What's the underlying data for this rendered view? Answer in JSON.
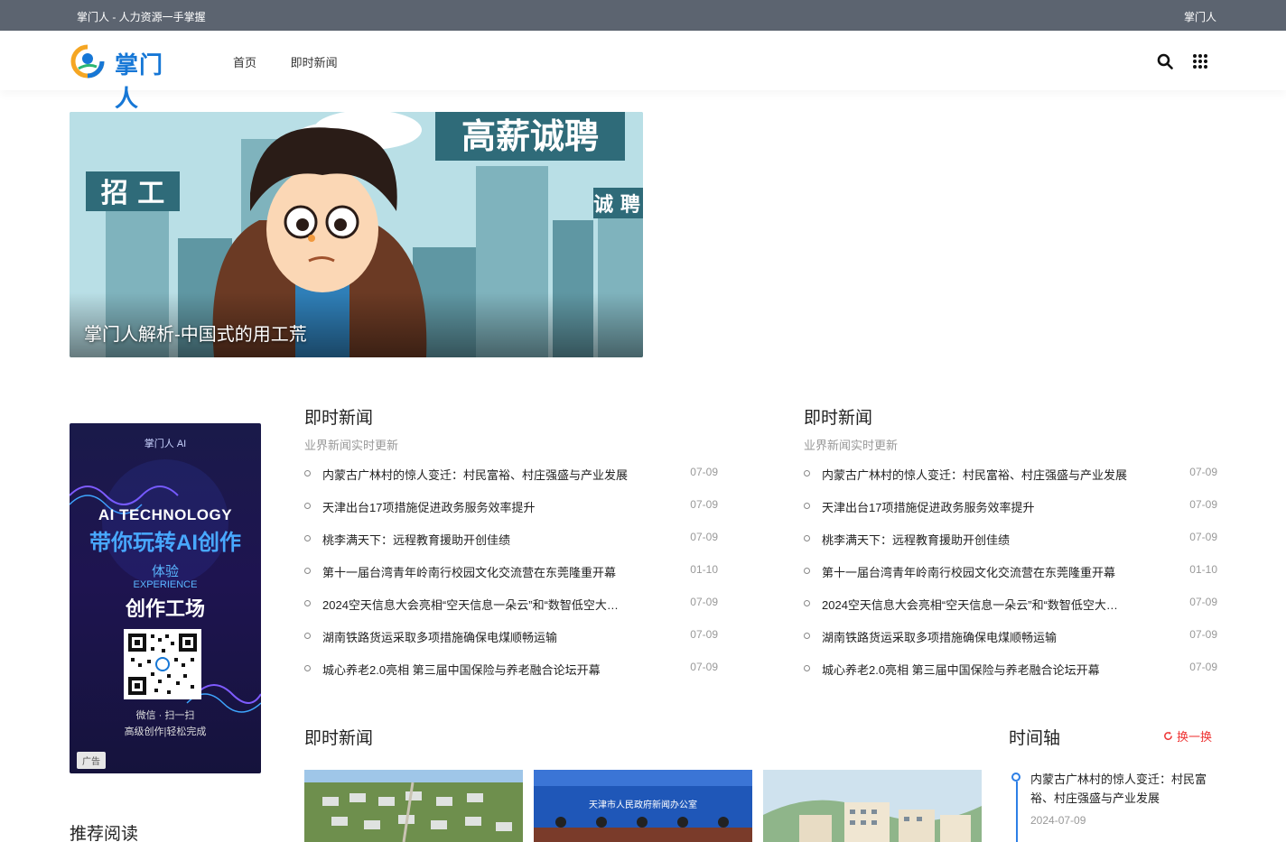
{
  "topbar": {
    "slogan": "掌门人 - 人力资源一手掌握",
    "brand": "掌门人"
  },
  "header": {
    "logo_text": "掌门人",
    "nav": [
      "首页",
      "即时新闻"
    ],
    "icons": [
      "search-icon",
      "grid-menu-icon"
    ]
  },
  "banner": {
    "caption": "掌门人解析-中国式的用工荒",
    "sign_left": "招 工",
    "sign_top": "高薪诚聘",
    "sign_right": "诚 聘"
  },
  "ad": {
    "brand": "掌门人 AI",
    "headline_en": "AI TECHNOLOGY",
    "headline_cn": "带你玩转AI创作",
    "line1": "体验",
    "line2": "EXPERIENCE",
    "line3": "创作工场",
    "scan": "微信 · 扫一扫",
    "done": "高级创作|轻松完成",
    "tag": "广告"
  },
  "news_col_1": {
    "title": "即时新闻",
    "subtitle": "业界新闻实时更新",
    "items": [
      {
        "title": "内蒙古广林村的惊人变迁：村民富裕、村庄强盛与产业发展",
        "date": "07-09"
      },
      {
        "title": "天津出台17项措施促进政务服务效率提升",
        "date": "07-09"
      },
      {
        "title": "桃李满天下：远程教育援助开创佳绩",
        "date": "07-09"
      },
      {
        "title": "第十一届台湾青年岭南行校园文化交流营在东莞隆重开幕",
        "date": "01-10"
      },
      {
        "title": "2024空天信息大会亮相“空天信息一朵云”和“数智低空大…",
        "date": "07-09"
      },
      {
        "title": "湖南铁路货运采取多项措施确保电煤顺畅运输",
        "date": "07-09"
      },
      {
        "title": "城心养老2.0亮相 第三届中国保险与养老融合论坛开幕",
        "date": "07-09"
      }
    ]
  },
  "news_col_2": {
    "title": "即时新闻",
    "subtitle": "业界新闻实时更新",
    "items": [
      {
        "title": "内蒙古广林村的惊人变迁：村民富裕、村庄强盛与产业发展",
        "date": "07-09"
      },
      {
        "title": "天津出台17项措施促进政务服务效率提升",
        "date": "07-09"
      },
      {
        "title": "桃李满天下：远程教育援助开创佳绩",
        "date": "07-09"
      },
      {
        "title": "第十一届台湾青年岭南行校园文化交流营在东莞隆重开幕",
        "date": "01-10"
      },
      {
        "title": "2024空天信息大会亮相“空天信息一朵云”和“数智低空大…",
        "date": "07-09"
      },
      {
        "title": "湖南铁路货运采取多项措施确保电煤顺畅运输",
        "date": "07-09"
      },
      {
        "title": "城心养老2.0亮相 第三届中国保险与养老融合论坛开幕",
        "date": "07-09"
      }
    ]
  },
  "recommend": {
    "title": "推荐阅读"
  },
  "bottom_news": {
    "title": "即时新闻",
    "thumb2_text": "天津市人民政府新闻办公室"
  },
  "timeline": {
    "title": "时间轴",
    "refresh": "换一换",
    "item": {
      "title": "内蒙古广林村的惊人变迁：村民富裕、村庄强盛与产业发展",
      "date": "2024-07-09"
    }
  },
  "colors": {
    "topbar": "#5c6470",
    "accent_blue": "#2d7fe6",
    "refresh_red": "#e33333"
  }
}
